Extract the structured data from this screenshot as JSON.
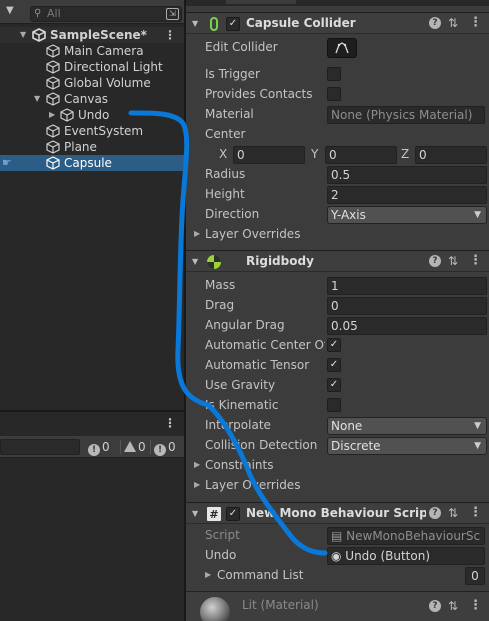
{
  "hierarchy": {
    "search_placeholder": "All",
    "scene": "SampleScene*",
    "items": [
      {
        "label": "Main Camera"
      },
      {
        "label": "Directional Light"
      },
      {
        "label": "Global Volume"
      },
      {
        "label": "Canvas"
      },
      {
        "label": "Undo"
      },
      {
        "label": "EventSystem"
      },
      {
        "label": "Plane"
      },
      {
        "label": "Capsule"
      }
    ]
  },
  "console": {
    "errors": "0",
    "warnings": "0",
    "messages": "0"
  },
  "capsule_collider": {
    "title": "Capsule Collider",
    "edit_collider_label": "Edit Collider",
    "is_trigger_label": "Is Trigger",
    "provides_contacts_label": "Provides Contacts",
    "material_label": "Material",
    "material_value": "None (Physics Material)",
    "center_label": "Center",
    "center": {
      "x_label": "X",
      "x": "0",
      "y_label": "Y",
      "y": "0",
      "z_label": "Z",
      "z": "0"
    },
    "radius_label": "Radius",
    "radius": "0.5",
    "height_label": "Height",
    "height": "2",
    "direction_label": "Direction",
    "direction": "Y-Axis",
    "layer_overrides_label": "Layer Overrides"
  },
  "rigidbody": {
    "title": "Rigidbody",
    "mass_label": "Mass",
    "mass": "1",
    "drag_label": "Drag",
    "drag": "0",
    "angular_drag_label": "Angular Drag",
    "angular_drag": "0.05",
    "auto_center_label": "Automatic Center Of",
    "auto_tensor_label": "Automatic Tensor",
    "use_gravity_label": "Use Gravity",
    "is_kinematic_label": "Is Kinematic",
    "interpolate_label": "Interpolate",
    "interpolate": "None",
    "collision_label": "Collision Detection",
    "collision": "Discrete",
    "constraints_label": "Constraints",
    "layer_overrides_label": "Layer Overrides"
  },
  "script_comp": {
    "title": "New Mono Behaviour Script (Sc",
    "script_label": "Script",
    "script_value": "NewMonoBehaviourSc",
    "undo_label": "Undo",
    "undo_value": "Undo (Button)",
    "command_list_label": "Command List",
    "command_list_count": "0"
  },
  "material": {
    "title": "Lit (Material)"
  },
  "colors": {
    "selection": "#2c5d87",
    "stroke": "#0a78d7",
    "panel": "#3c3c3c"
  }
}
